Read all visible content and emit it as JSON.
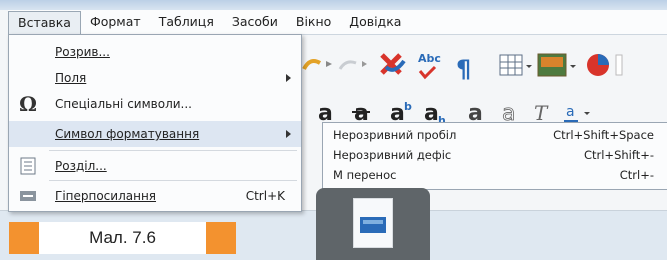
{
  "menubar": {
    "items": [
      "Вставка",
      "Формат",
      "Таблиця",
      "Засоби",
      "Вікно",
      "Довідка"
    ]
  },
  "menu": {
    "items": [
      {
        "label": "Розрив...",
        "shortcut": "",
        "submenu": false
      },
      {
        "label": "Поля",
        "shortcut": "",
        "submenu": true
      },
      {
        "label": "Спеціальні символи...",
        "shortcut": "",
        "submenu": false
      },
      {
        "label": "Символ форматування",
        "shortcut": "",
        "submenu": true
      },
      {
        "label": "Розділ...",
        "shortcut": "",
        "submenu": false
      },
      {
        "label": "Гіперпосилання",
        "shortcut": "Ctrl+K",
        "submenu": false
      }
    ]
  },
  "submenu": {
    "items": [
      {
        "label": "Нерозривний пробіл",
        "shortcut": "Ctrl+Shift+Space"
      },
      {
        "label": "Нерозривний дефіс",
        "shortcut": "Ctrl+Shift+-"
      },
      {
        "label": "М   перенос",
        "shortcut": "Ctrl+-"
      }
    ]
  },
  "caption": {
    "text": "Мал. 7.6"
  },
  "colors": {
    "accent": "#f3922f",
    "highlight": "#dde6f2",
    "tile": "#5f6569"
  },
  "toolbar": {
    "icons": [
      "redo-icon",
      "clear-format-icon",
      "spellcheck-icon",
      "pilcrow-icon",
      "table-icon",
      "image-icon",
      "chart-icon"
    ],
    "format_icons": [
      "text-style-icon",
      "strikethrough-icon",
      "superscript-icon",
      "subscript-icon",
      "bold-a-icon",
      "shadow-a-icon",
      "italic-icon",
      "font-color-icon"
    ]
  }
}
